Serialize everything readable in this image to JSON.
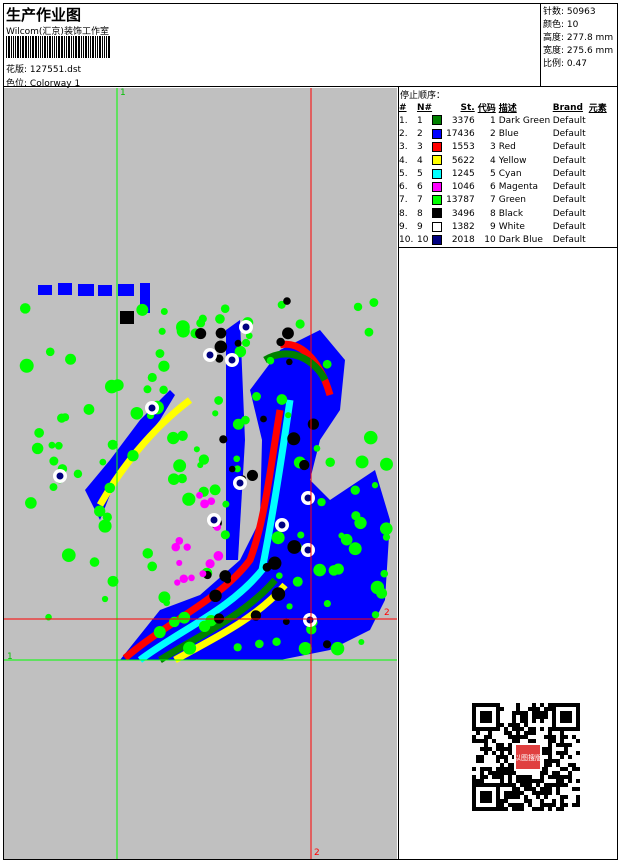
{
  "header": {
    "title": "生产作业图",
    "company": "Wilcom(汇京)装饰工作室",
    "design_label": "花版:",
    "design_value": "127551.dst",
    "colorway_label": "色位:",
    "colorway_value": "Colorway 1"
  },
  "info": [
    {
      "label": "针数:",
      "value": "50963"
    },
    {
      "label": "颜色:",
      "value": "10"
    },
    {
      "label": "高度:",
      "value": "277.8 mm"
    },
    {
      "label": "宽度:",
      "value": "275.6 mm"
    },
    {
      "label": "比例:",
      "value": "0.47"
    }
  ],
  "stop_sequence": {
    "title": "停止顺序：",
    "columns": [
      "#",
      "N#",
      "St.",
      "代码",
      "描述",
      "Brand",
      "元素"
    ],
    "rows": [
      {
        "idx": "1.",
        "n": "1",
        "color": "#008000",
        "st": "3376",
        "code": "1",
        "desc": "Dark Green",
        "brand": "Default"
      },
      {
        "idx": "2.",
        "n": "2",
        "color": "#0000ff",
        "st": "17436",
        "code": "2",
        "desc": "Blue",
        "brand": "Default"
      },
      {
        "idx": "3.",
        "n": "3",
        "color": "#ff0000",
        "st": "1553",
        "code": "3",
        "desc": "Red",
        "brand": "Default"
      },
      {
        "idx": "4.",
        "n": "4",
        "color": "#ffff00",
        "st": "5622",
        "code": "4",
        "desc": "Yellow",
        "brand": "Default"
      },
      {
        "idx": "5.",
        "n": "5",
        "color": "#00ffff",
        "st": "1245",
        "code": "5",
        "desc": "Cyan",
        "brand": "Default"
      },
      {
        "idx": "6.",
        "n": "6",
        "color": "#ff00ff",
        "st": "1046",
        "code": "6",
        "desc": "Magenta",
        "brand": "Default"
      },
      {
        "idx": "7.",
        "n": "7",
        "color": "#00ff00",
        "st": "13787",
        "code": "7",
        "desc": "Green",
        "brand": "Default"
      },
      {
        "idx": "8.",
        "n": "8",
        "color": "#000000",
        "st": "3496",
        "code": "8",
        "desc": "Black",
        "brand": "Default"
      },
      {
        "idx": "9.",
        "n": "9",
        "color": "#ffffff",
        "st": "1382",
        "code": "9",
        "desc": "White",
        "brand": "Default"
      },
      {
        "idx": "10.",
        "n": "10",
        "color": "#000080",
        "st": "2018",
        "code": "10",
        "desc": "Dark Blue",
        "brand": "Default"
      }
    ]
  },
  "guides": {
    "green_top": "1",
    "green_left": "1",
    "red_bottom": "2",
    "red_right": "2"
  },
  "qr": {
    "stamp": "以图搜版"
  }
}
